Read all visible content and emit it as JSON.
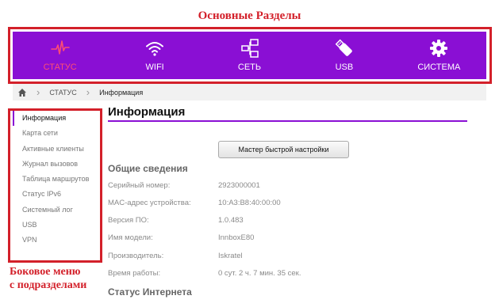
{
  "annotations": {
    "top_label": "Основные Разделы",
    "side_label_line1": "Боковое меню",
    "side_label_line2": "с подразделами",
    "color": "#d3202a"
  },
  "theme": {
    "accent": "#8a0fd4",
    "active_nav": "#ff4d73"
  },
  "nav": {
    "items": [
      {
        "label": "СТАТУС",
        "icon": "pulse-icon",
        "active": true
      },
      {
        "label": "WIFI",
        "icon": "wifi-icon",
        "active": false
      },
      {
        "label": "СЕТЬ",
        "icon": "network-icon",
        "active": false
      },
      {
        "label": "USB",
        "icon": "usb-icon",
        "active": false
      },
      {
        "label": "СИСТЕМА",
        "icon": "gear-icon",
        "active": false
      }
    ]
  },
  "breadcrumb": {
    "home_icon": "home-icon",
    "section": "СТАТУС",
    "current": "Информация"
  },
  "sidebar": {
    "items": [
      {
        "label": "Информация",
        "active": true
      },
      {
        "label": "Карта сети"
      },
      {
        "label": "Активные клиенты"
      },
      {
        "label": "Журнал вызовов"
      },
      {
        "label": "Таблица маршрутов"
      },
      {
        "label": "Статус IPv6"
      },
      {
        "label": "Системный лог"
      },
      {
        "label": "USB"
      },
      {
        "label": "VPN"
      }
    ]
  },
  "main": {
    "title": "Информация",
    "wizard_button": "Мастер быстрой настройки",
    "general_title": "Общие сведения",
    "rows": [
      {
        "label": "Серийный номер:",
        "value": "2923000001"
      },
      {
        "label": "MAC-адрес устройства:",
        "value": "10:A3:B8:40:00:00"
      },
      {
        "label": "Версия ПО:",
        "value": "1.0.483"
      },
      {
        "label": "Имя модели:",
        "value": "InnboxE80"
      },
      {
        "label": "Производитель:",
        "value": "Iskratel"
      },
      {
        "label": "Время работы:",
        "value": "0 сут. 2 ч. 7 мин. 35 сек."
      }
    ],
    "internet_title": "Статус Интернета"
  }
}
